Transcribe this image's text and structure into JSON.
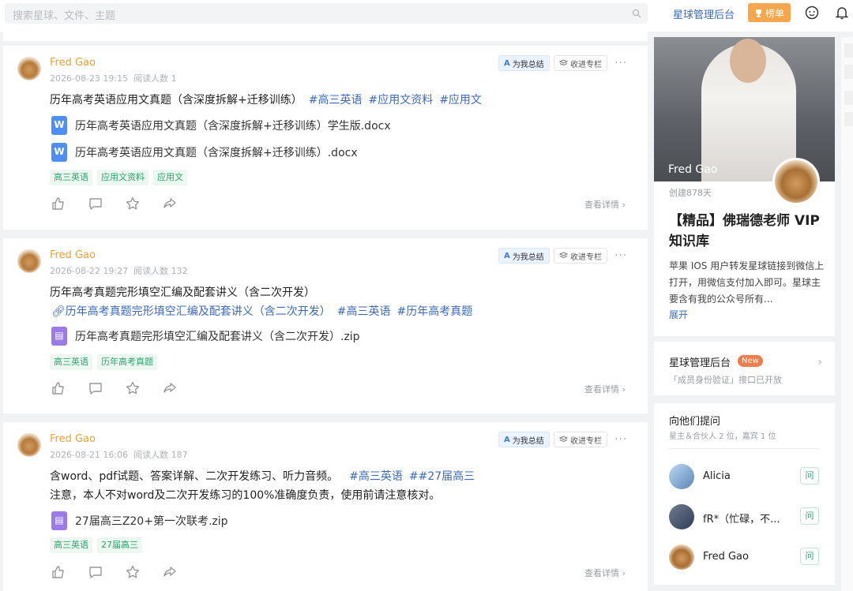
{
  "search": {
    "placeholder": "搜索星球、文件、主题"
  },
  "topnav": {
    "admin_label": "星球管理后台",
    "rank_label": "榜单"
  },
  "posts": [
    {
      "author": "Fred Gao",
      "date": "2026-08-23 19:15",
      "reads": "阅读人数 1",
      "ai_label": "为我总结",
      "collect_label": "收进专栏",
      "text": "历年高考英语应用文真题（含深度拆解+迁移训练）",
      "hashtags": [
        "#高三英语",
        "#应用文资料",
        "#应用文"
      ],
      "files": [
        {
          "type": "word",
          "name": "历年高考英语应用文真题（含深度拆解+迁移训练）学生版.docx"
        },
        {
          "type": "word",
          "name": "历年高考英语应用文真题（含深度拆解+迁移训练）.docx"
        }
      ],
      "tags": [
        "高三英语",
        "应用文资料",
        "应用文"
      ],
      "detail_label": "查看详情"
    },
    {
      "author": "Fred Gao",
      "date": "2026-08-22 19:27",
      "reads": "阅读人数 132",
      "ai_label": "为我总结",
      "collect_label": "收进专栏",
      "text": "历年高考真题完形填空汇编及配套讲义（含二次开发）",
      "link_text": "历年高考真题完形填空汇编及配套讲义（含二次开发）",
      "hashtags": [
        "#高三英语",
        "#历年高考真题"
      ],
      "files": [
        {
          "type": "zip",
          "name": "历年高考真题完形填空汇编及配套讲义（含二次开发）.zip"
        }
      ],
      "tags": [
        "高三英语",
        "历年高考真题"
      ],
      "detail_label": "查看详情"
    },
    {
      "author": "Fred Gao",
      "date": "2026-08-21 16:06",
      "reads": "阅读人数 187",
      "ai_label": "为我总结",
      "collect_label": "收进专栏",
      "text": "含word、pdf试题、答案详解、二次开发练习、听力音频。",
      "hashtags": [
        "#高三英语",
        "##27届高三"
      ],
      "text2": "注意，本人不对word及二次开发练习的100%准确度负责，使用前请注意核对。",
      "files": [
        {
          "type": "zip",
          "name": "27届高三Z20+第一次联考.zip"
        }
      ],
      "tags": [
        "高三英语",
        "27届高三"
      ],
      "detail_label": "查看详情"
    }
  ],
  "sidebar": {
    "owner_name": "Fred Gao",
    "created": "创建878天",
    "title": "【精品】佛瑞德老师 VIP 知识库",
    "desc": "苹果 IOS 用户转发星球链接到微信上打开，用微信支付加入即可。星球主要含有我的公众号所有...",
    "expand_label": "展开",
    "mgmt": {
      "title": "星球管理后台",
      "badge": "New",
      "sub": "「成员身份验证」接口已开放"
    },
    "ask": {
      "title": "向他们提问",
      "sub": "星主＆合伙人 2 位，嘉宾 1 位",
      "btn_label": "问",
      "people": [
        {
          "name": "Alicia"
        },
        {
          "name": "fR*（忙碌，不..."
        },
        {
          "name": "Fred Gao"
        }
      ]
    }
  },
  "colors": {
    "accent": "#3d6ab8",
    "author": "#e9a23b",
    "tag_bg": "#ecf8f1",
    "tag_fg": "#2aa56f",
    "rank_btn": "#f6a64d"
  }
}
